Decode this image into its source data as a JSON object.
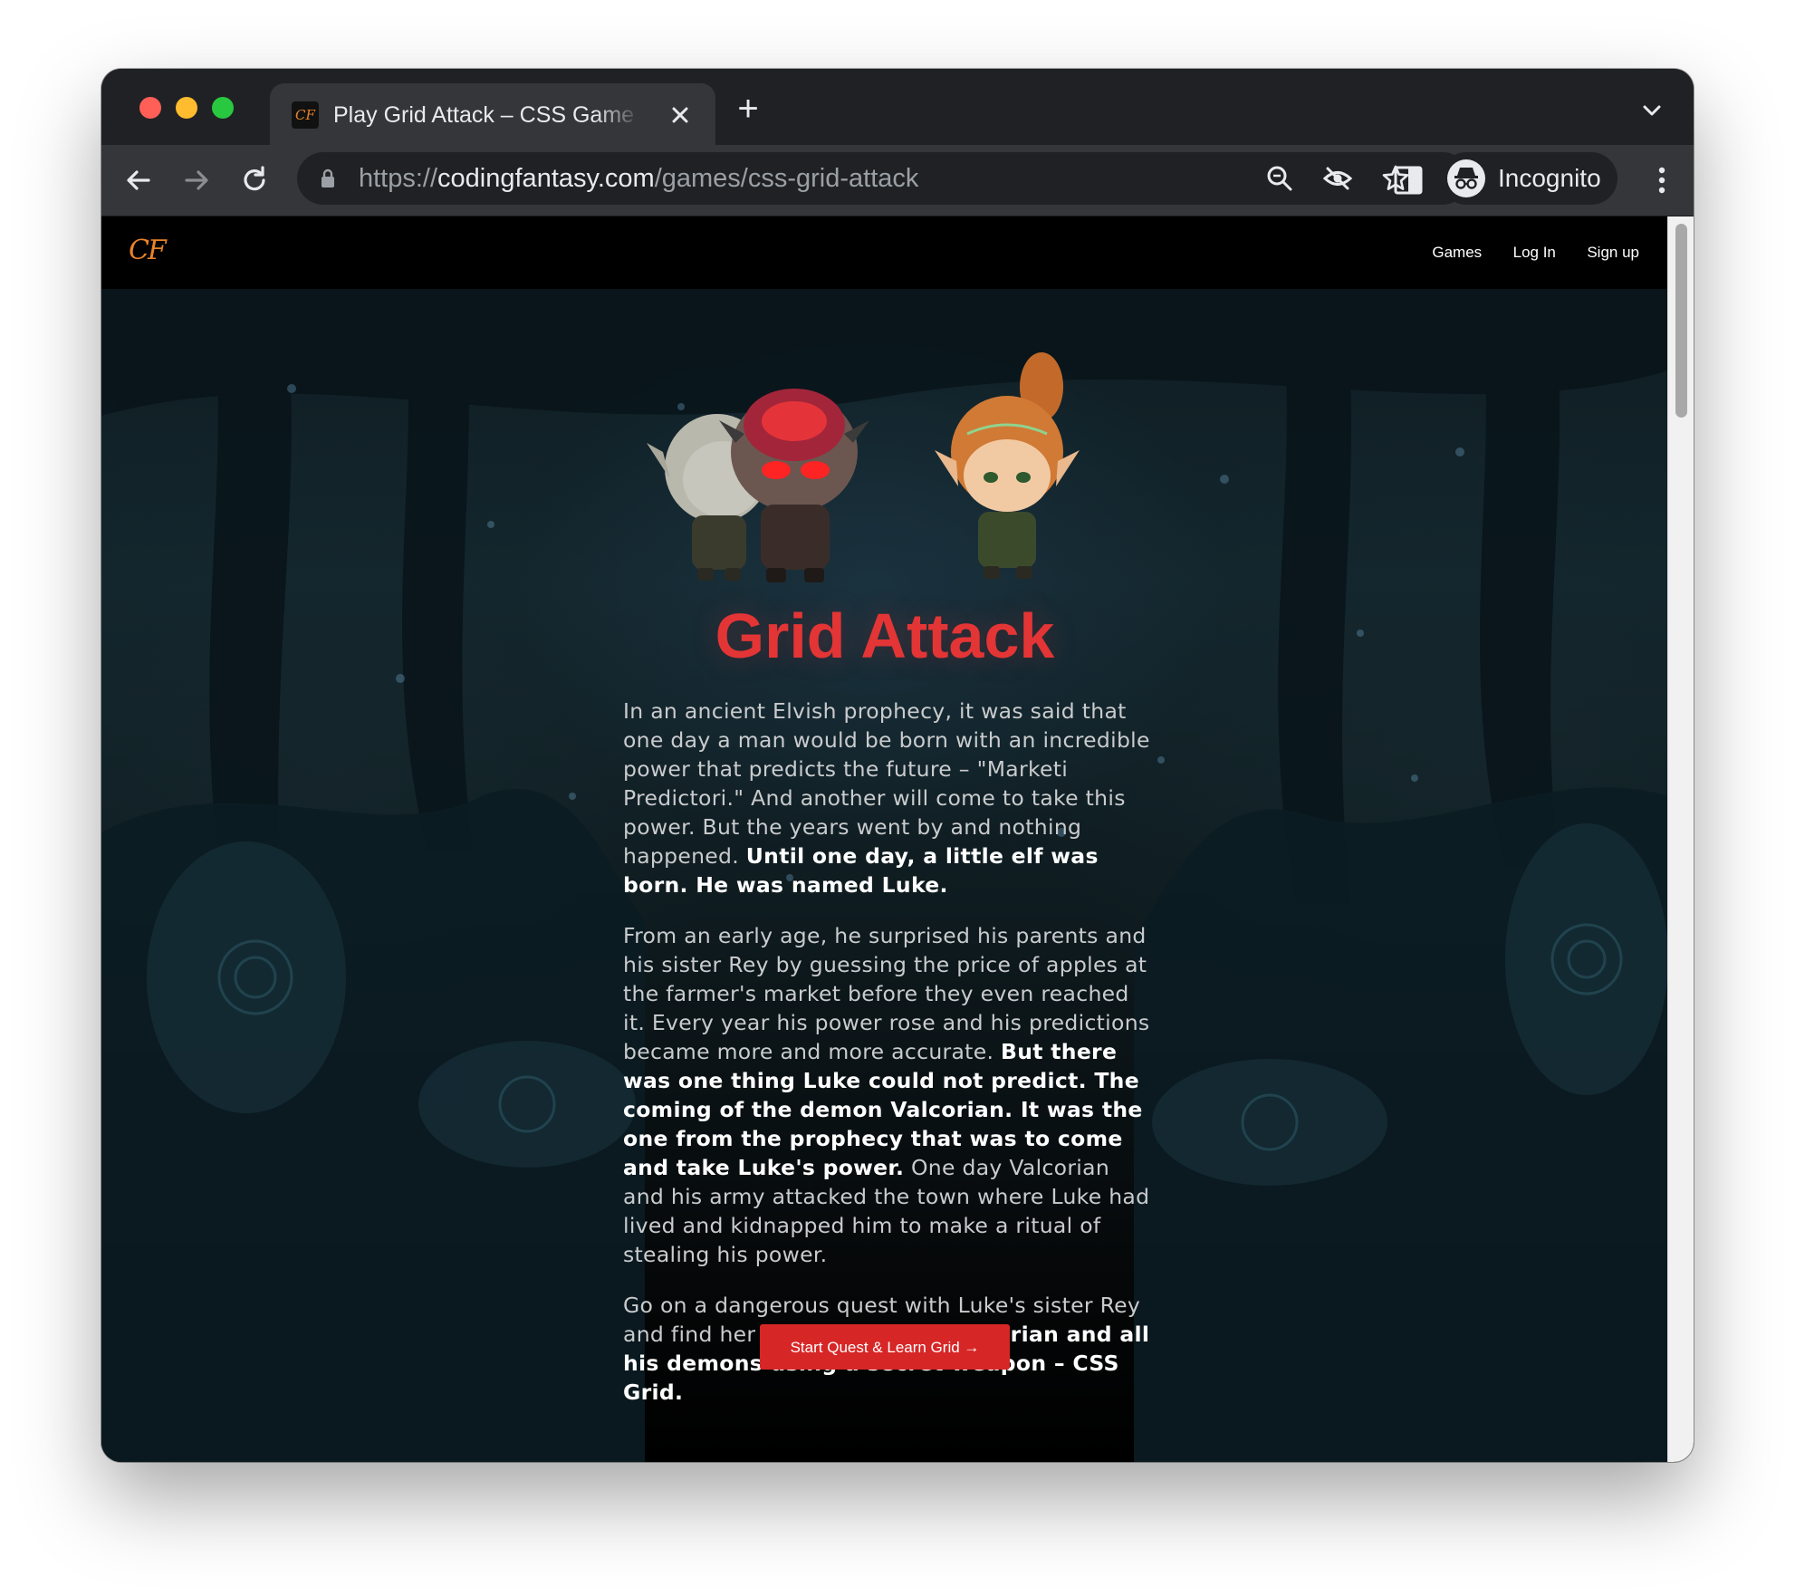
{
  "browser": {
    "tab": {
      "favicon_text": "CF",
      "title": "Play Grid Attack – CSS Game to Learn CSS Grid"
    },
    "new_tab_symbol": "+",
    "url": {
      "scheme": "https://",
      "domain": "codingfantasy.com",
      "path": "/games/css-grid-attack"
    },
    "profile_label": "Incognito",
    "icons": [
      "back-icon",
      "forward-icon",
      "reload-icon",
      "lock-icon",
      "zoom-icon",
      "eye-off-icon",
      "star-icon",
      "side-panel-icon",
      "incognito-icon",
      "more-vert-icon",
      "tab-close-icon",
      "chevron-down-icon"
    ]
  },
  "site": {
    "logo_text": "CF",
    "nav": {
      "games": "Games",
      "login": "Log In",
      "signup": "Sign up"
    }
  },
  "hero": {
    "title": "Grid Attack",
    "p1_normal": "In an ancient Elvish prophecy, it was said that one day a man would be born with an incredible power that predicts the future – \"Marketi Predictori.\" And another will come to take this power. But the years went by and nothing happened. ",
    "p1_bold": "Until one day, a little elf was born. He was named Luke.",
    "p2_normal_a": "From an early age, he surprised his parents and his sister Rey by guessing the price of apples at the farmer's market before they even reached it. Every year his power rose and his predictions became more and more accurate. ",
    "p2_bold": "But there was one thing Luke could not predict. The coming of the demon Valcorian. It was the one from the prophecy that was to come and take Luke's power.",
    "p2_normal_b": " One day Valcorian and his army attacked the town where Luke had lived and kidnapped him to make a ritual of stealing his power.",
    "p3_normal": "Go on a dangerous quest with Luke's sister Rey and find her brother. ",
    "p3_bold": "Defeat Valcorian and all his demons using a secret weapon – CSS Grid.",
    "cta_label": "Start Quest & Learn Grid →"
  },
  "colors": {
    "title_red": "#e33535",
    "cta_red": "#d72626",
    "logo_orange": "#e8832a",
    "chrome_dark": "#202124",
    "chrome_toolbar": "#35363a"
  }
}
